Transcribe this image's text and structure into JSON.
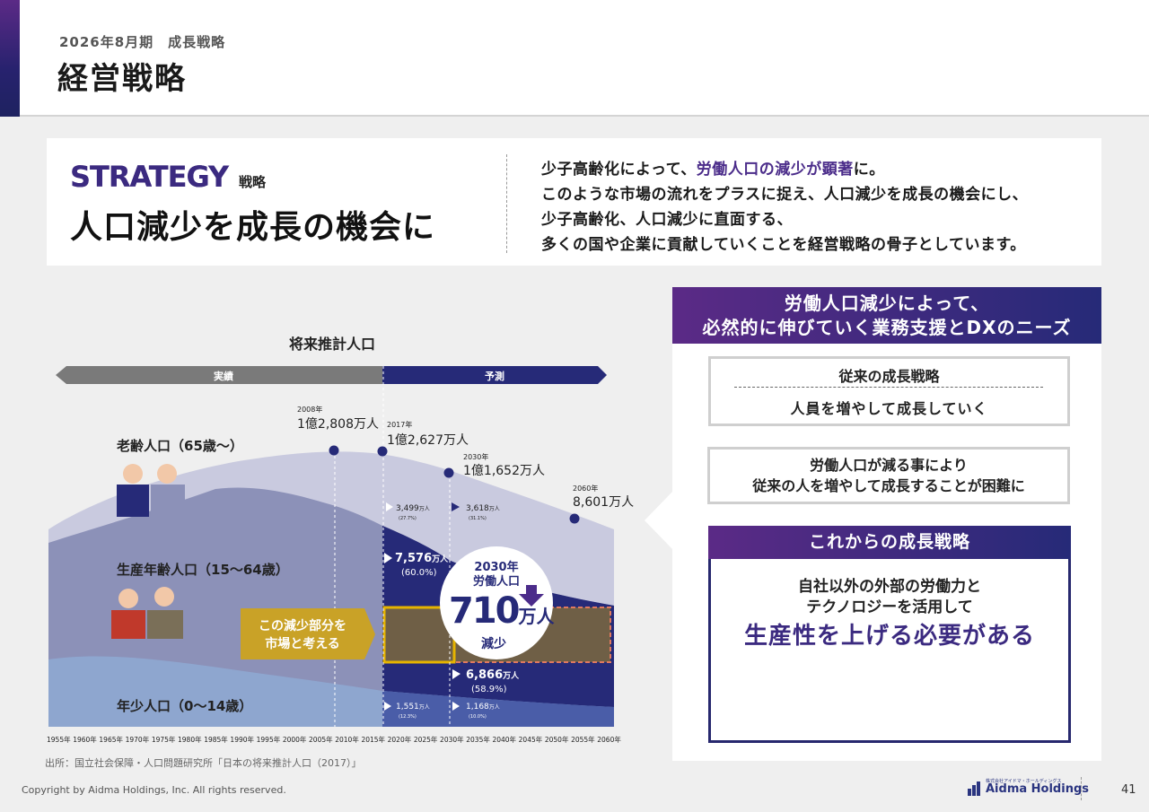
{
  "header": {
    "subtitle": "2026年8月期　成長戦略",
    "title": "経営戦略"
  },
  "strategy": {
    "word": "STRATEGY",
    "word_jp": "戦略",
    "headline": "人口減少を成長の機会に",
    "line1_a": "少子高齢化によって、",
    "line1_hl": "労働人口の減少が顕著",
    "line1_b": "に。",
    "line2": "このような市場の流れをプラスに捉え、人口減少を成長の機会にし、",
    "line3": "少子高齢化、人口減少に直面する、",
    "line4": "多くの国や企業に貢献していくことを経営戦略の骨子としています。"
  },
  "chart": {
    "title": "将来推計人口",
    "band_actual": "実績",
    "band_forecast": "予測",
    "label_elderly": "老齢人口（65歳〜）",
    "label_working": "生産年齢人口（15〜64歳）",
    "label_young": "年少人口（0〜14歳）",
    "p2008_year": "2008年",
    "p2008_val": "1億2,808万人",
    "p2017_year": "2017年",
    "p2017_val": "1億2,627万人",
    "p2030_year": "2030年",
    "p2030_val": "1億1,652万人",
    "p2060_year": "2060年",
    "p2060_val": "8,601万人",
    "e2017_val": "3,499",
    "e2017_unit": "万人",
    "e2017_pct": "(27.7%)",
    "e2030_val": "3,618",
    "e2030_unit": "万人",
    "e2030_pct": "(31.1%)",
    "w2017_val": "7,576",
    "w2017_unit": "万人",
    "w2017_pct": "(60.0%)",
    "w2030_val": "6,866",
    "w2030_unit": "万人",
    "w2030_pct": "(58.9%)",
    "y2017_val": "1,551",
    "y2017_unit": "万人",
    "y2017_pct": "(12.3%)",
    "y2030_val": "1,168",
    "y2030_unit": "万人",
    "y2030_pct": "(10.0%)",
    "callout_year": "2030年",
    "callout_label": "労働人口",
    "callout_num": "710",
    "callout_unit": "万人",
    "callout_down": "減少",
    "market_line1": "この減少部分を",
    "market_line2": "市場と考える",
    "ticks": [
      "1955年",
      "1960年",
      "1965年",
      "1970年",
      "1975年",
      "1980年",
      "1985年",
      "1990年",
      "1995年",
      "2000年",
      "2005年",
      "2010年",
      "2015年",
      "2020年",
      "2025年",
      "2030年",
      "2035年",
      "2040年",
      "2045年",
      "2050年",
      "2055年",
      "2060年"
    ],
    "source": "出所：国立社会保障・人口問題研究所「日本の将来推計人口（2017）」"
  },
  "right_panel": {
    "head1": "労働人口減少によって、",
    "head2": "必然的に伸びていく業務支援とDXのニーズ",
    "box1_title": "従来の成長戦略",
    "box1_text": "人員を増やして成長していく",
    "box2_line1": "労働人口が減る事により",
    "box2_line2": "従来の人を増やして成長することが困難に",
    "box3_head": "これからの成長戦略",
    "box3_line1": "自社以外の外部の労働力と",
    "box3_line2": "テクノロジーを活用して",
    "box3_big": "生産性を上げる必要がある"
  },
  "footer": {
    "copyright": "Copyright by Aidma Holdings, Inc. All rights reserved.",
    "logo_small": "株式会社アイドマ・ホールディングス",
    "logo": "Aidma Holdings",
    "page": "41"
  },
  "colors": {
    "brand_purple": "#5b2a86",
    "brand_navy": "#262a78",
    "market_gold": "#c9a227"
  }
}
